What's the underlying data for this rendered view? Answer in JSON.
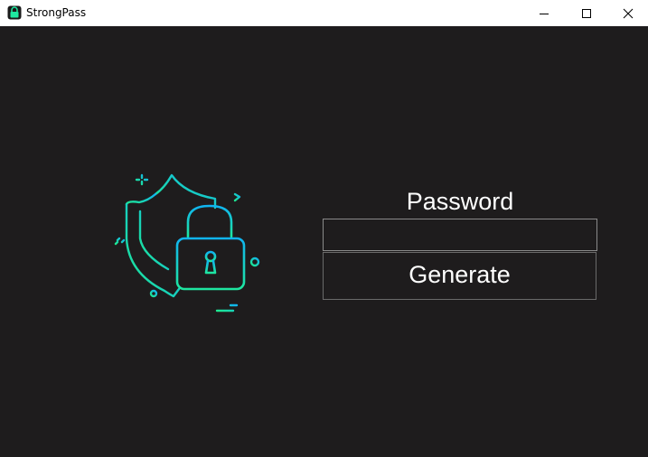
{
  "window": {
    "title": "StrongPass",
    "app_icon": "padlock-icon",
    "controls": {
      "minimize": "minimize-icon",
      "maximize": "maximize-icon",
      "close": "close-icon"
    }
  },
  "illustration": {
    "icon": "shield-padlock-icon",
    "colors": {
      "gradient_start": "#1ee98f",
      "gradient_end": "#10b4f0"
    }
  },
  "form": {
    "password_label": "Password",
    "password_value": "",
    "generate_label": "Generate"
  },
  "colors": {
    "background": "#1e1c1d",
    "titlebar": "#ffffff",
    "text": "#ffffff",
    "border": "#8a8a8a"
  }
}
